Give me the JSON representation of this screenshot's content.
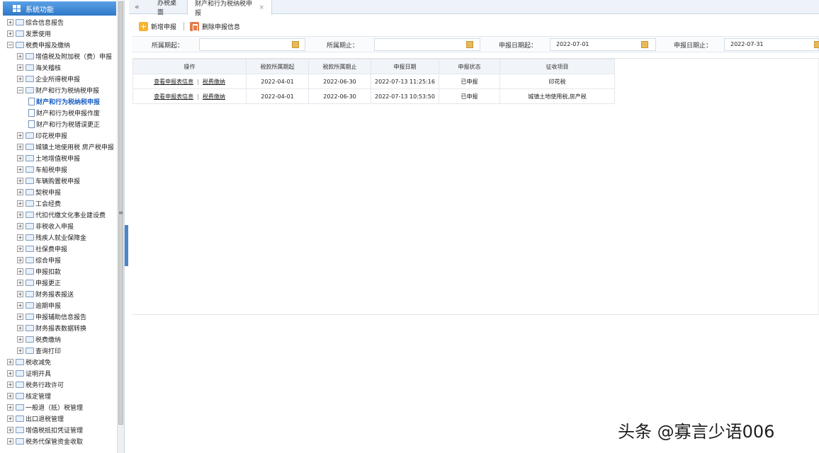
{
  "sidebar": {
    "title": "系统功能",
    "items": [
      {
        "label": "综合信息报告",
        "type": "folder",
        "depth": 0,
        "exp": "+"
      },
      {
        "label": "发票使用",
        "type": "folder",
        "depth": 0,
        "exp": "+"
      },
      {
        "label": "税费申报及缴纳",
        "type": "folder",
        "depth": 0,
        "exp": "−"
      },
      {
        "label": "增值税及附加税（费）申报",
        "type": "folder",
        "depth": 1,
        "exp": "+"
      },
      {
        "label": "海关稽核",
        "type": "folder",
        "depth": 1,
        "exp": "+"
      },
      {
        "label": "企业所得税申报",
        "type": "folder",
        "depth": 1,
        "exp": "+"
      },
      {
        "label": "财产和行为税纳税申报",
        "type": "folder",
        "depth": 1,
        "exp": "−"
      },
      {
        "label": "财产和行为税纳税申报",
        "type": "doc",
        "depth": 2,
        "exp": "",
        "active": true
      },
      {
        "label": "财产和行为税申报作废",
        "type": "doc",
        "depth": 2,
        "exp": ""
      },
      {
        "label": "财产和行为税错误更正",
        "type": "doc",
        "depth": 2,
        "exp": ""
      },
      {
        "label": "印花税申报",
        "type": "folder",
        "depth": 1,
        "exp": "+"
      },
      {
        "label": "城镇土地使用税 房产税申报",
        "type": "folder",
        "depth": 1,
        "exp": "+"
      },
      {
        "label": "土地增值税申报",
        "type": "folder",
        "depth": 1,
        "exp": "+"
      },
      {
        "label": "车船税申报",
        "type": "folder",
        "depth": 1,
        "exp": "+"
      },
      {
        "label": "车辆购置税申报",
        "type": "folder",
        "depth": 1,
        "exp": "+"
      },
      {
        "label": "契税申报",
        "type": "folder",
        "depth": 1,
        "exp": "+"
      },
      {
        "label": "工会经费",
        "type": "folder",
        "depth": 1,
        "exp": "+"
      },
      {
        "label": "代扣代缴文化事业建设费",
        "type": "folder",
        "depth": 1,
        "exp": "+"
      },
      {
        "label": "非税收入申报",
        "type": "folder",
        "depth": 1,
        "exp": "+"
      },
      {
        "label": "残疾人就业保障金",
        "type": "folder",
        "depth": 1,
        "exp": "+"
      },
      {
        "label": "社保费申报",
        "type": "folder",
        "depth": 1,
        "exp": "+"
      },
      {
        "label": "综合申报",
        "type": "folder",
        "depth": 1,
        "exp": "+"
      },
      {
        "label": "申报扣款",
        "type": "folder",
        "depth": 1,
        "exp": "+"
      },
      {
        "label": "申报更正",
        "type": "folder",
        "depth": 1,
        "exp": "+"
      },
      {
        "label": "财务报表报送",
        "type": "folder",
        "depth": 1,
        "exp": "+"
      },
      {
        "label": "逾期申报",
        "type": "folder",
        "depth": 1,
        "exp": "+"
      },
      {
        "label": "申报辅助信息报告",
        "type": "folder",
        "depth": 1,
        "exp": "+"
      },
      {
        "label": "财务报表数据转换",
        "type": "folder",
        "depth": 1,
        "exp": "+"
      },
      {
        "label": "税费缴纳",
        "type": "folder",
        "depth": 1,
        "exp": "+"
      },
      {
        "label": "查询打印",
        "type": "folder",
        "depth": 1,
        "exp": "+"
      },
      {
        "label": "税收减免",
        "type": "folder",
        "depth": 0,
        "exp": "+"
      },
      {
        "label": "证明开具",
        "type": "folder",
        "depth": 0,
        "exp": "+"
      },
      {
        "label": "税务行政许可",
        "type": "folder",
        "depth": 0,
        "exp": "+"
      },
      {
        "label": "核定管理",
        "type": "folder",
        "depth": 0,
        "exp": "+"
      },
      {
        "label": "一般退（抵）税管理",
        "type": "folder",
        "depth": 0,
        "exp": "+"
      },
      {
        "label": "出口退税管理",
        "type": "folder",
        "depth": 0,
        "exp": "+"
      },
      {
        "label": "增值税抵扣凭证管理",
        "type": "folder",
        "depth": 0,
        "exp": "+"
      },
      {
        "label": "税务代保管资金收取",
        "type": "folder",
        "depth": 0,
        "exp": "+"
      }
    ]
  },
  "tabs": {
    "scroll_glyph": "«",
    "home": "办税桌面",
    "active": "财产和行为税纳税申报",
    "close_glyph": "×"
  },
  "toolbar": {
    "new_label": "新增申报",
    "delete_label": "删除申报信息"
  },
  "filter": {
    "period_start_label": "所属期起：",
    "period_start_value": "",
    "period_end_label": "所属期止：",
    "period_end_value": "",
    "decl_start_label": "申报日期起：",
    "decl_start_value": "2022-07-01",
    "decl_end_label": "申报日期止：",
    "decl_end_value": "2022-07-31"
  },
  "table": {
    "headers": [
      "操作",
      "税款所属期起",
      "税款所属期止",
      "申报日期",
      "申报状态",
      "征收项目"
    ],
    "rows": [
      {
        "op1": "查看申报表信息",
        "sep": "|",
        "op2": "税费缴纳",
        "start": "2022-04-01",
        "end": "2022-06-30",
        "date": "2022-07-13 11:25:16",
        "status": "已申报",
        "item": "印花税"
      },
      {
        "op1": "查看申报表信息",
        "sep": "|",
        "op2": "税费缴纳",
        "start": "2022-04-01",
        "end": "2022-06-30",
        "date": "2022-07-13 10:53:50",
        "status": "已申报",
        "item": "城镇土地使用税,房产税"
      }
    ]
  },
  "watermark": "头条 @寡言少语006",
  "colors": {
    "sidebar_header": "#2f78c8",
    "active_link": "#1a5fc0",
    "new_icon": "#f5b335",
    "delete_icon": "#e27a4a"
  }
}
